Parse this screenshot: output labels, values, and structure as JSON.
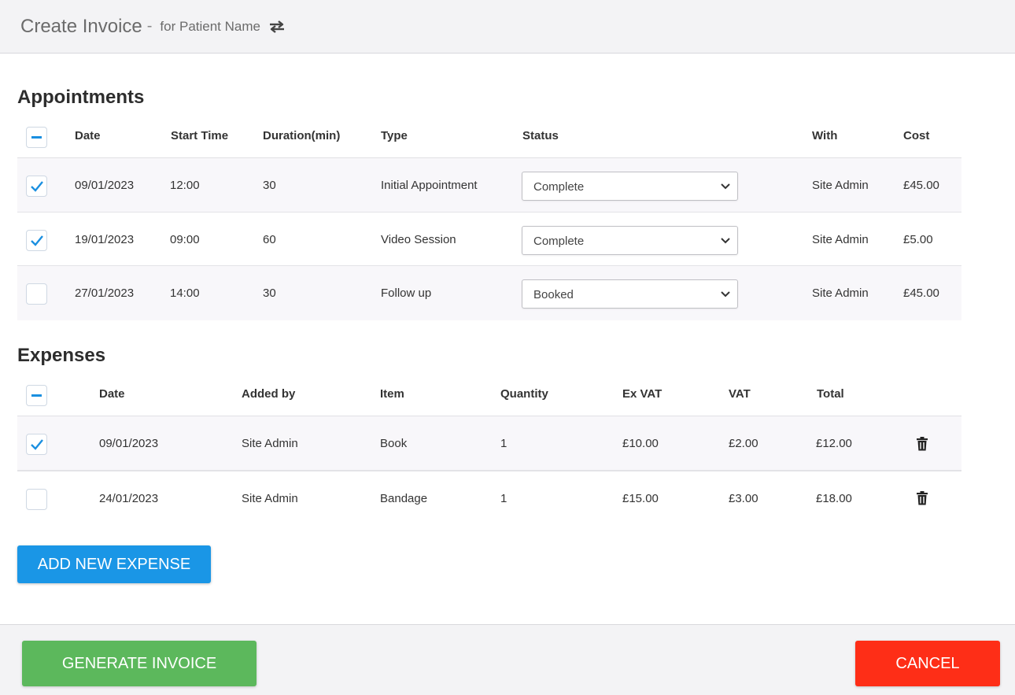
{
  "header": {
    "title": "Create Invoice",
    "dash": "-",
    "subtitle": "for Patient Name",
    "swap_icon": "swap-arrows-icon"
  },
  "appointments": {
    "title": "Appointments",
    "columns": [
      "Date",
      "Start Time",
      "Duration(min)",
      "Type",
      "Status",
      "With",
      "Cost"
    ],
    "rows": [
      {
        "checked": true,
        "date": "09/01/2023",
        "start": "12:00",
        "duration": "30",
        "type": "Initial Appointment",
        "status": "Complete",
        "with": "Site Admin",
        "cost": "£45.00"
      },
      {
        "checked": true,
        "date": "19/01/2023",
        "start": "09:00",
        "duration": "60",
        "type": "Video Session",
        "status": "Complete",
        "with": "Site Admin",
        "cost": "£5.00"
      },
      {
        "checked": false,
        "date": "27/01/2023",
        "start": "14:00",
        "duration": "30",
        "type": "Follow up",
        "status": "Booked",
        "with": "Site Admin",
        "cost": "£45.00"
      }
    ]
  },
  "expenses": {
    "title": "Expenses",
    "columns": [
      "Date",
      "Added by",
      "Item",
      "Quantity",
      "Ex VAT",
      "VAT",
      "Total"
    ],
    "rows": [
      {
        "checked": true,
        "date": "09/01/2023",
        "added_by": "Site Admin",
        "item": "Book",
        "quantity": "1",
        "ex_vat": "£10.00",
        "vat": "£2.00",
        "total": "£12.00"
      },
      {
        "checked": false,
        "date": "24/01/2023",
        "added_by": "Site Admin",
        "item": "Bandage",
        "quantity": "1",
        "ex_vat": "£15.00",
        "vat": "£3.00",
        "total": "£18.00"
      }
    ],
    "add_button": "ADD NEW EXPENSE"
  },
  "footer": {
    "generate_button": "GENERATE INVOICE",
    "cancel_button": "CANCEL"
  },
  "colors": {
    "accent": "#1a96e6",
    "success": "#5cb85c",
    "danger": "#fe2e17"
  }
}
